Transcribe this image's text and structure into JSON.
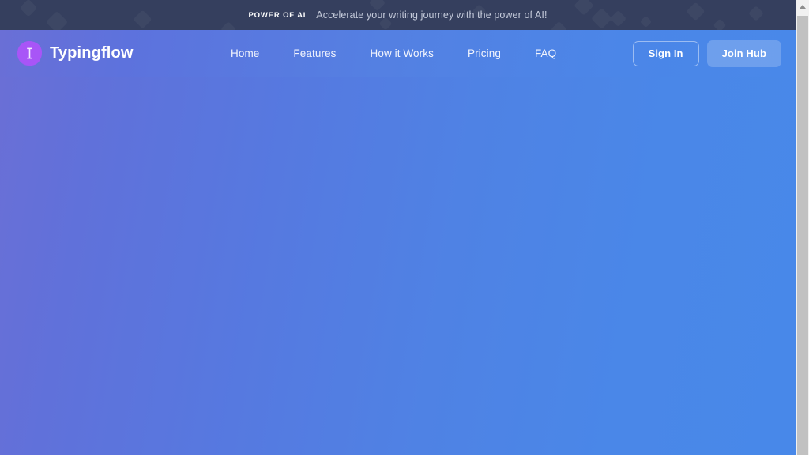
{
  "announcement": {
    "badge": "POWER OF AI",
    "message": "Accelerate your writing journey with the power of AI!",
    "background_color": "#353f5e",
    "badge_color": "#ffffff",
    "message_color": "#c5cbdb"
  },
  "header": {
    "brand": {
      "name": "Typingflow",
      "icon": "text-cursor-brain-icon",
      "icon_color": "#a855f7",
      "text_color": "#ffffff"
    },
    "nav": [
      {
        "label": "Home"
      },
      {
        "label": "Features"
      },
      {
        "label": "How it Works"
      },
      {
        "label": "Pricing"
      },
      {
        "label": "FAQ"
      }
    ],
    "actions": {
      "sign_in_label": "Sign In",
      "join_hub_label": "Join Hub"
    },
    "gradient_from": "#6a6fd6",
    "gradient_to": "#4888e9"
  },
  "main": {
    "gradient_from": "#6a6fd6",
    "gradient_to": "#4888e9"
  },
  "scrollbar": {
    "up_arrow_icon": "chevron-up-icon",
    "track_color": "#f1f1f1",
    "thumb_color": "#c1c1c1"
  }
}
